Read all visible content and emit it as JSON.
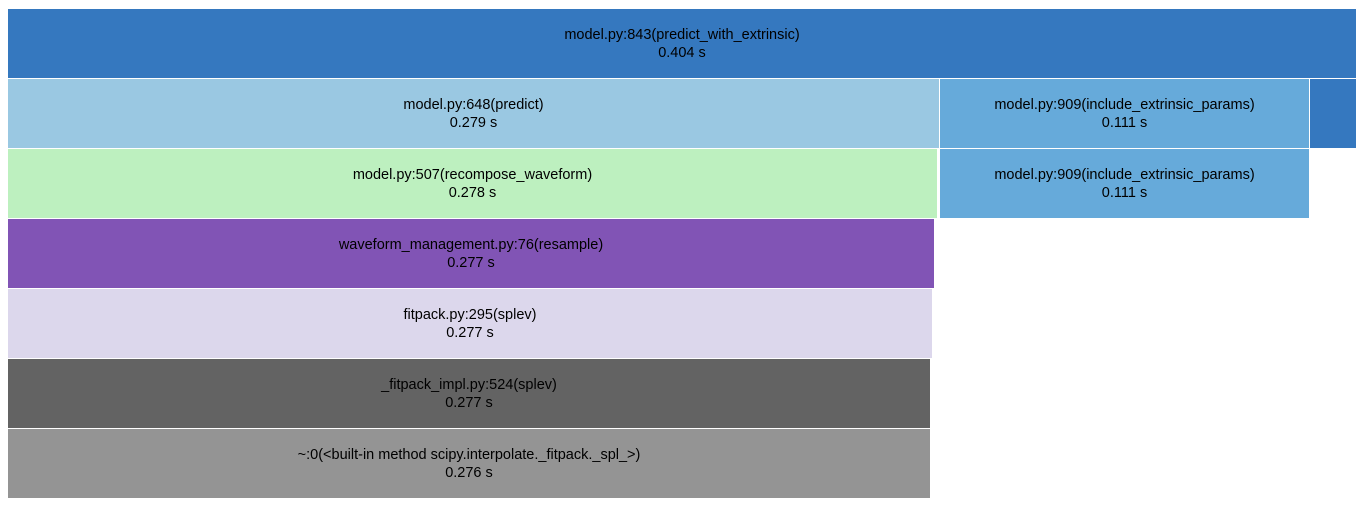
{
  "frames": [
    {
      "id": "f0",
      "label": "model.py:843(predict_with_extrinsic)",
      "time": "0.404 s",
      "color": "#3578bf",
      "text_color": "#000000"
    },
    {
      "id": "f1",
      "label": "model.py:648(predict)",
      "time": "0.279 s",
      "color": "#9ac8e2",
      "text_color": "#000000"
    },
    {
      "id": "f2",
      "label": "model.py:909(include_extrinsic_params)",
      "time": "0.111 s",
      "color": "#66aada",
      "text_color": "#000000"
    },
    {
      "id": "f3",
      "label": "",
      "time": "",
      "color": "#3578bf",
      "text_color": "#000000"
    },
    {
      "id": "f4",
      "label": "model.py:507(recompose_waveform)",
      "time": "0.278 s",
      "color": "#bdf0bf",
      "text_color": "#000000"
    },
    {
      "id": "f5",
      "label": "model.py:909(include_extrinsic_params)",
      "time": "0.111 s",
      "color": "#66aada",
      "text_color": "#000000"
    },
    {
      "id": "f6",
      "label": "waveform_management.py:76(resample)",
      "time": "0.277 s",
      "color": "#8154b5",
      "text_color": "#000000"
    },
    {
      "id": "f7",
      "label": "fitpack.py:295(splev)",
      "time": "0.277 s",
      "color": "#dcd7ec",
      "text_color": "#000000"
    },
    {
      "id": "f8",
      "label": "_fitpack_impl.py:524(splev)",
      "time": "0.277 s",
      "color": "#636363",
      "text_color": "#000000"
    },
    {
      "id": "f9",
      "label": "~:0(<built-in method scipy.interpolate._fitpack._spl_>)",
      "time": "0.276 s",
      "color": "#949494",
      "text_color": "#000000"
    }
  ]
}
